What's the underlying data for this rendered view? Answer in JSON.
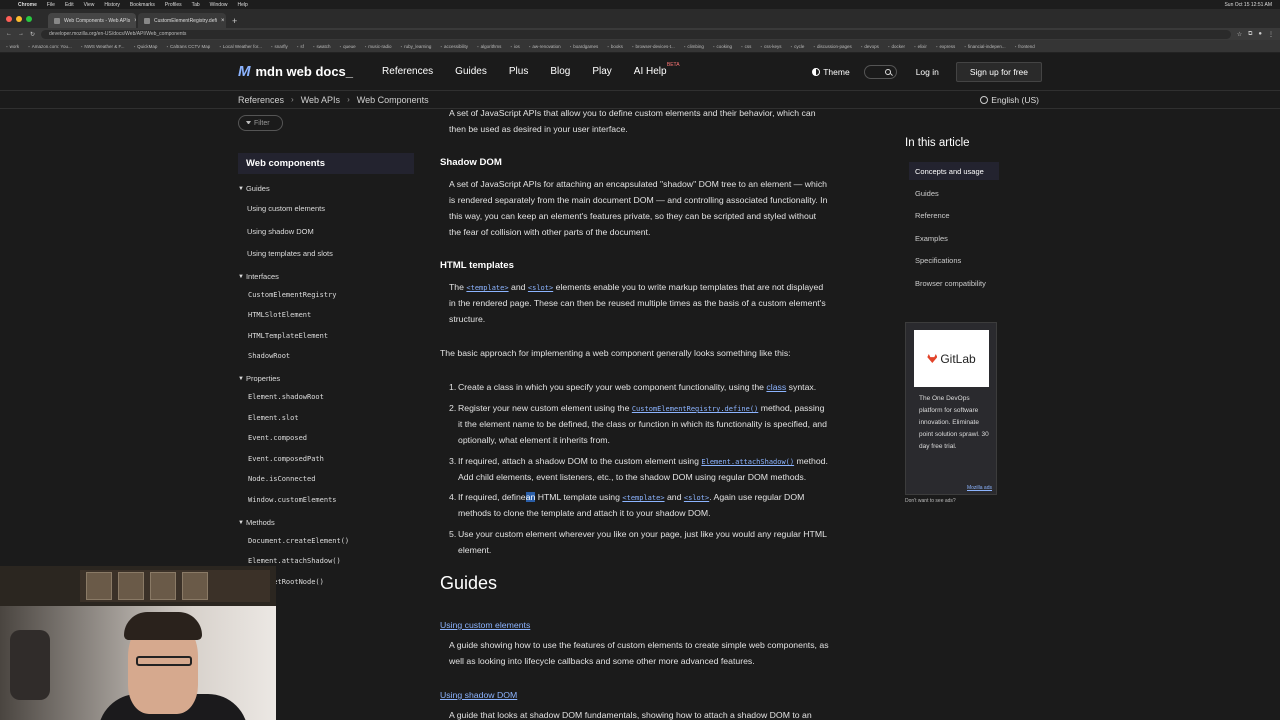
{
  "menubar": {
    "app": "Chrome",
    "items": [
      "File",
      "Edit",
      "View",
      "History",
      "Bookmarks",
      "Profiles",
      "Tab",
      "Window",
      "Help"
    ],
    "clock": "Sun Oct 15 12:51 AM"
  },
  "tabs": [
    {
      "label": "Web Components - Web APIs"
    },
    {
      "label": "CustomElementRegistry.defi"
    }
  ],
  "address": {
    "url": "developer.mozilla.org/en-US/docs/Web/API/Web_components"
  },
  "bookmarks": [
    "work",
    "Amazon.com: You...",
    "NWS Weather & F...",
    "QuickMap",
    "Caltrans CCTV Map",
    "Local Weather for...",
    "snarfly",
    "sf",
    "swatch",
    "queue",
    "music-radio",
    "ruby_learning",
    "accessibility",
    "algorithms",
    "ios",
    "aw-renovation",
    "boardgames",
    "books",
    "browser-devices-t...",
    "climbing",
    "cooking",
    "css",
    "css-keys",
    "cycle",
    "discussion-pages",
    "devops",
    "docker",
    "elixir",
    "express",
    "financial-indepen...",
    "frontend"
  ],
  "mdn": {
    "logo": "mdn web docs_",
    "nav": [
      "References",
      "Guides",
      "Plus",
      "Blog",
      "Play",
      "AI Help"
    ],
    "beta": "BETA",
    "theme": "Theme",
    "login": "Log in",
    "signup": "Sign up for free"
  },
  "breadcrumb": [
    "References",
    "Web APIs",
    "Web Components"
  ],
  "language": "English (US)",
  "sidebar": {
    "filter_placeholder": "Filter",
    "title": "Web components",
    "groups": {
      "guides": "Guides",
      "interfaces": "Interfaces",
      "properties": "Properties",
      "methods": "Methods"
    },
    "guides": [
      "Using custom elements",
      "Using shadow DOM",
      "Using templates and slots"
    ],
    "interfaces": [
      "CustomElementRegistry",
      "HTMLSlotElement",
      "HTMLTemplateElement",
      "ShadowRoot"
    ],
    "properties": [
      "Element.shadowRoot",
      "Element.slot",
      "Event.composed",
      "Event.composedPath",
      "Node.isConnected",
      "Window.customElements"
    ],
    "methods": [
      "Document.createElement()",
      "Element.attachShadow()",
      "Node.getRootNode()"
    ]
  },
  "content": {
    "intro_line1": "A set of JavaScript APIs that allow you to define custom elements and their behavior, which can",
    "intro_line2": "then be used as desired in your user interface.",
    "shadow_title": "Shadow DOM",
    "shadow_l1": "A set of JavaScript APIs for attaching an encapsulated \"shadow\" DOM tree to an element — which",
    "shadow_l2": "is rendered separately from the main document DOM — and controlling associated functionality. In",
    "shadow_l3": "this way, you can keep an element's features private, so they can be scripted and styled without",
    "shadow_l4": "the fear of collision with other parts of the document.",
    "templates_title": "HTML templates",
    "tpl_the": "The",
    "tpl_code1": "<template>",
    "tpl_and": "and",
    "tpl_code2": "<slot>",
    "tpl_rest1": "elements enable you to write markup templates that are not displayed",
    "tpl_l2": "in the rendered page. These can then be reused multiple times as the basis of a custom element's",
    "tpl_l3": "structure.",
    "approach": "The basic approach for implementing a web component generally looks something like this:",
    "step1_a": "Create a class in which you specify your web component functionality, using the",
    "step1_link": "class",
    "step1_b": "syntax.",
    "step2_a": "Register your new custom element using the",
    "step2_code": "CustomElementRegistry.define()",
    "step2_b": "method, passing",
    "step2_l2": "it the element name to be defined, the class or function in which its functionality is specified, and",
    "step2_l3": "optionally, what element it inherits from.",
    "step3_a": "If required, attach a shadow DOM to the custom element using",
    "step3_code": "Element.attachShadow()",
    "step3_b": "method.",
    "step3_l2": "Add child elements, event listeners, etc., to the shadow DOM using regular DOM methods.",
    "step4_a": "If required, define",
    "step4_hl": "an",
    "step4_b": "HTML template using",
    "step4_code1": "<template>",
    "step4_and": "and",
    "step4_code2": "<slot>",
    "step4_c": ". Again use regular DOM",
    "step4_l2": "methods to clone the template and attach it to your shadow DOM.",
    "step5_l1": "Use your custom element wherever you like on your page, just like you would any regular HTML",
    "step5_l2": "element.",
    "guides_title": "Guides",
    "guide1_link": "Using custom elements",
    "guide1_l1": "A guide showing how to use the features of custom elements to create simple web components, as",
    "guide1_l2": "well as looking into lifecycle callbacks and some other more advanced features.",
    "guide2_link": "Using shadow DOM",
    "guide2_l1": "A guide that looks at shadow DOM fundamentals, showing how to attach a shadow DOM to an"
  },
  "toc": {
    "title": "In this article",
    "items": [
      "Concepts and usage",
      "Guides",
      "Reference",
      "Examples",
      "Specifications",
      "Browser compatibility"
    ]
  },
  "ad": {
    "brand": "GitLab",
    "text": "The One DevOps platform for software innovation. Eliminate point solution sprawl. 30 day free trial.",
    "by": "Mozilla ads",
    "note": "Don't want to see ads?"
  },
  "colors": {
    "accent": "#8cb4ff",
    "background": "#1b1b1b",
    "highlight": "#2a5ea8"
  }
}
